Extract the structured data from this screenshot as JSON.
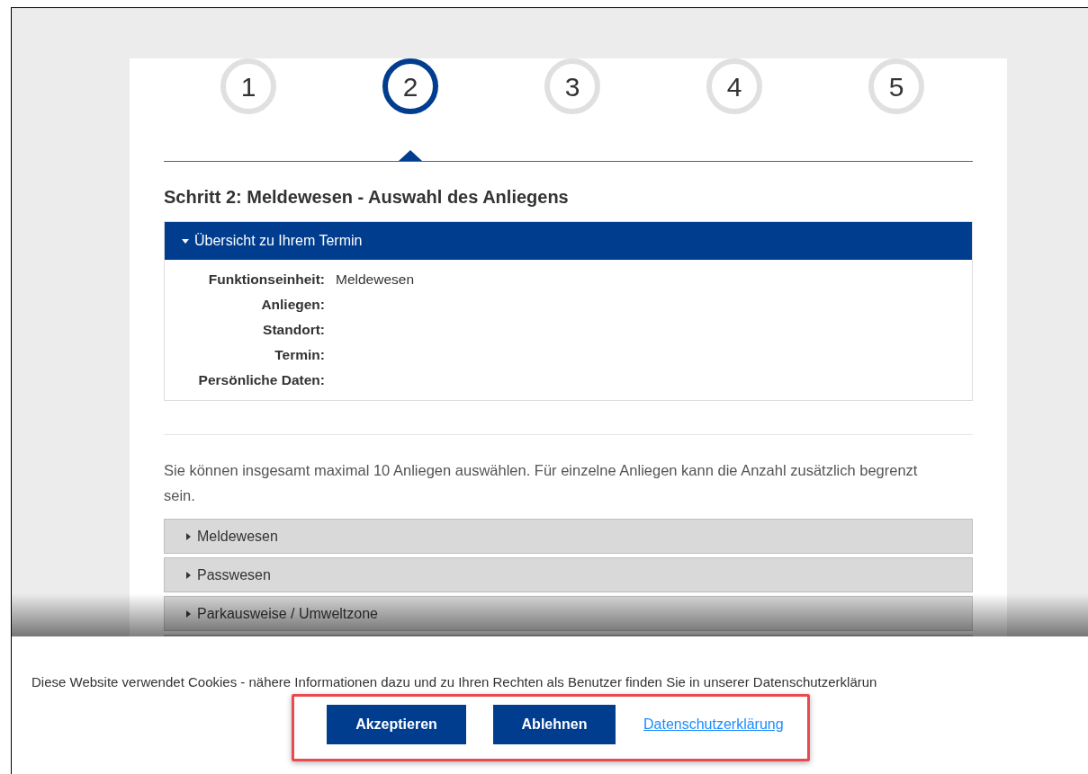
{
  "steps": [
    {
      "label": "1",
      "selected": false
    },
    {
      "label": "2",
      "selected": true
    },
    {
      "label": "3",
      "selected": false
    },
    {
      "label": "4",
      "selected": false
    },
    {
      "label": "5",
      "selected": false
    }
  ],
  "heading": "Schritt 2: Meldewesen - Auswahl des Anliegens",
  "overview": {
    "title": "Übersicht zu Ihrem Termin",
    "expanded": true,
    "fields": [
      {
        "label": "Funktionseinheit:",
        "value": "Meldewesen"
      },
      {
        "label": "Anliegen:"
      },
      {
        "label": "Standort:"
      },
      {
        "label": "Termin:"
      },
      {
        "label": "Persönliche Daten:"
      }
    ]
  },
  "hint": "Sie können insgesamt maximal 10 Anliegen auswählen. Für einzelne Anliegen kann die Anzahl zusätzlich begrenzt sein.",
  "categories": [
    {
      "label": "Meldewesen",
      "expanded": false
    },
    {
      "label": "Passwesen",
      "expanded": false
    },
    {
      "label": "Parkausweise / Umweltzone",
      "expanded": false
    }
  ],
  "cookie_banner": {
    "text": "Diese Website verwendet Cookies - nähere Informationen dazu und zu Ihren Rechten als Benutzer finden Sie in unserer Datenschutzerklärun",
    "buttons": [
      "Akzeptieren",
      "Ablehnen"
    ],
    "link": "Datenschutzerklärung"
  }
}
